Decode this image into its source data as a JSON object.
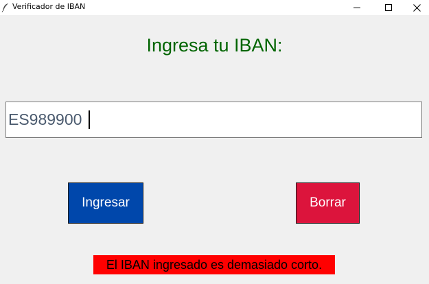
{
  "window": {
    "title": "Verificador de IBAN",
    "icon": "feather-icon",
    "controls": [
      "minimize-icon",
      "maximize-icon",
      "close-icon"
    ]
  },
  "heading": {
    "text": "Ingresa tu IBAN:",
    "color": "#006400"
  },
  "iban_input": {
    "value": "ES989900",
    "text_color": "#4a5a6e"
  },
  "buttons": {
    "submit": {
      "label": "Ingresar",
      "background": "#0047ab",
      "text_color": "#ffffff"
    },
    "clear": {
      "label": "Borrar",
      "background": "#dc143c",
      "text_color": "#ffffff"
    }
  },
  "status": {
    "message": "El IBAN ingresado es demasiado corto.",
    "background": "#ff0000",
    "text_color": "#000000"
  },
  "colors": {
    "window_background": "#f0f0f0",
    "titlebar_background": "#ffffff"
  }
}
